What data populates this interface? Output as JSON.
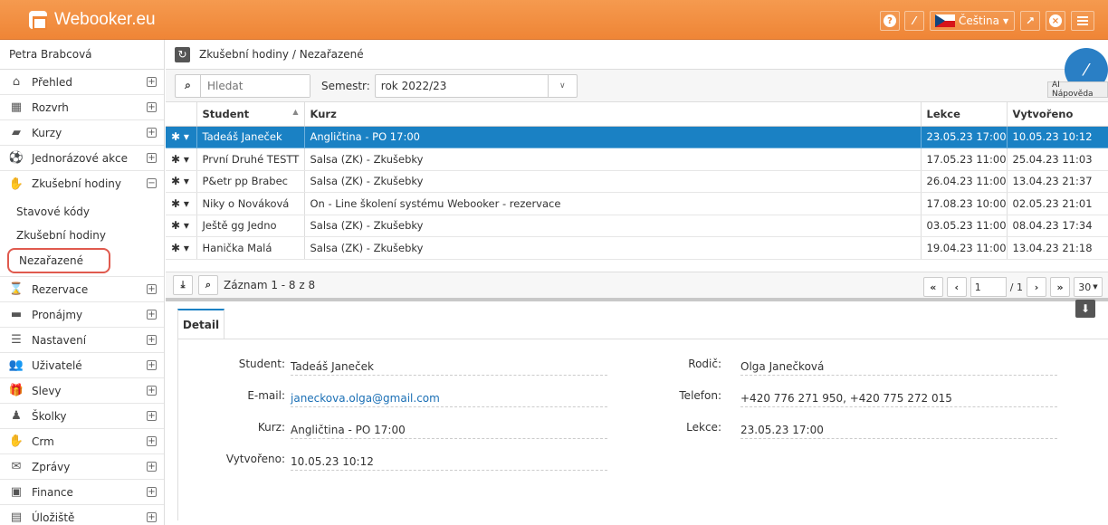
{
  "app": {
    "title": "Webooker.eu"
  },
  "topbar": {
    "language": "Čeština"
  },
  "sidebar": {
    "user": "Petra Brabcová",
    "items": [
      {
        "label": "Přehled",
        "icon": "home-icon"
      },
      {
        "label": "Rozvrh",
        "icon": "calendar-icon"
      },
      {
        "label": "Kurzy",
        "icon": "book-icon"
      },
      {
        "label": "Jednorázové akce",
        "icon": "ball-icon"
      },
      {
        "label": "Zkušební hodiny",
        "icon": "handshake-icon"
      }
    ],
    "sub": [
      "Stavové kódy",
      "Zkušební hodiny",
      "Nezařazené"
    ],
    "items2": [
      {
        "label": "Rezervace",
        "icon": "hourglass-icon"
      },
      {
        "label": "Pronájmy",
        "icon": "bed-icon"
      },
      {
        "label": "Nastavení",
        "icon": "settings-icon"
      },
      {
        "label": "Uživatelé",
        "icon": "users-icon"
      },
      {
        "label": "Slevy",
        "icon": "gift-icon"
      },
      {
        "label": "Školky",
        "icon": "child-icon"
      },
      {
        "label": "Crm",
        "icon": "handshake-icon"
      },
      {
        "label": "Zprávy",
        "icon": "envelope-icon"
      },
      {
        "label": "Finance",
        "icon": "money-icon"
      },
      {
        "label": "Úložiště",
        "icon": "storage-icon"
      }
    ]
  },
  "breadcrumb": "Zkušební hodiny / Nezařazené",
  "toolbar": {
    "search_placeholder": "Hledat",
    "semester_label": "Semestr:",
    "semester_value": "rok 2022/23",
    "ai_tip": "AI Nápověda"
  },
  "table": {
    "headers": [
      "Student",
      "Kurz",
      "Lekce",
      "Vytvořeno"
    ],
    "rows": [
      [
        "Tadeáš Janeček",
        "Angličtina - PO 17:00",
        "23.05.23 17:00",
        "10.05.23 10:12"
      ],
      [
        "První Druhé TESTT",
        "Salsa (ZK) - Zkušebky",
        "17.05.23 11:00",
        "25.04.23 11:03"
      ],
      [
        "P&etr pp Brabec",
        "Salsa (ZK) - Zkušebky",
        "26.04.23 11:00",
        "13.04.23 21:37"
      ],
      [
        "Niky o Nováková",
        "On - Line školení systému Webooker - rezervace",
        "17.08.23 10:00",
        "02.05.23 21:01"
      ],
      [
        "Ještě gg Jedno",
        "Salsa (ZK) - Zkušebky",
        "03.05.23 11:00",
        "08.04.23 17:34"
      ],
      [
        "Hanička Malá",
        "Salsa (ZK) - Zkušebky",
        "19.04.23 11:00",
        "13.04.23 21:18"
      ]
    ]
  },
  "pager": {
    "records": "Záznam 1 - 8 z 8",
    "page": "1",
    "total": "/ 1",
    "size": "30"
  },
  "detail": {
    "tab": "Detail",
    "student_label": "Student:",
    "student": "Tadeáš Janeček",
    "email_label": "E-mail:",
    "email": "janeckova.olga@gmail.com",
    "kurz_label": "Kurz:",
    "kurz": "Angličtina - PO 17:00",
    "created_label": "Vytvořeno:",
    "created": "10.05.23 10:12",
    "parent_label": "Rodič:",
    "parent": "Olga Janečková",
    "phone_label": "Telefon:",
    "phone": "+420 776 271 950, +420 775 272 015",
    "lesson_label": "Lekce:",
    "lesson": "23.05.23 17:00"
  }
}
